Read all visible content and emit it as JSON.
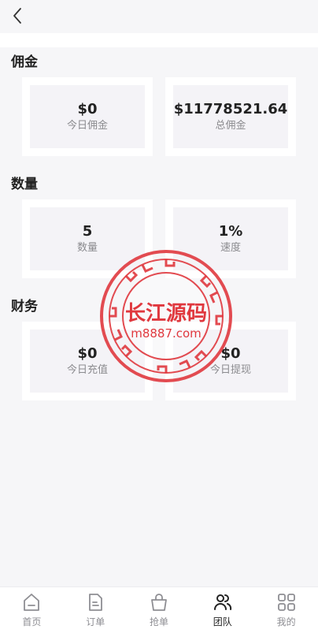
{
  "sections": [
    {
      "title": "佣金",
      "cards": [
        {
          "value": "$0",
          "label": "今日佣金"
        },
        {
          "value": "$11778521.64",
          "label": "总佣金"
        }
      ]
    },
    {
      "title": "数量",
      "cards": [
        {
          "value": "5",
          "label": "数量"
        },
        {
          "value": "1%",
          "label": "速度"
        }
      ]
    },
    {
      "title": "财务",
      "cards": [
        {
          "value": "$0",
          "label": "今日充值"
        },
        {
          "value": "$0",
          "label": "今日提现"
        }
      ]
    }
  ],
  "watermark": {
    "line1": "长江源码",
    "line2": "m8887.com",
    "color": "#e0383e"
  },
  "tabbar": {
    "items": [
      {
        "label": "首页",
        "icon": "home-icon"
      },
      {
        "label": "订单",
        "icon": "document-icon"
      },
      {
        "label": "抢单",
        "icon": "bag-icon"
      },
      {
        "label": "团队",
        "icon": "team-icon",
        "active": true
      },
      {
        "label": "我的",
        "icon": "grid-icon"
      }
    ]
  }
}
